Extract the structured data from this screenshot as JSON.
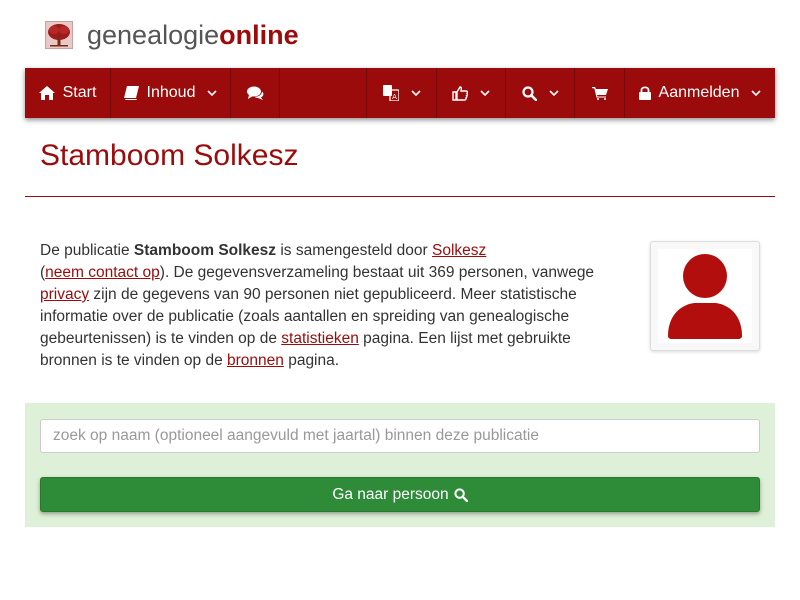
{
  "brand": {
    "name_part1": "genealogie",
    "name_part2": "online",
    "logo_icon": "tree-logo-icon"
  },
  "nav": {
    "start_label": "Start",
    "inhoud_label": "Inhoud",
    "aanmelden_label": "Aanmelden",
    "icons": [
      "home-icon",
      "book-icon",
      "comments-icon",
      "translate-icon",
      "thumbs-up-icon",
      "search-icon",
      "cart-icon",
      "lock-icon"
    ]
  },
  "page": {
    "title": "Stamboom Solkesz"
  },
  "intro": {
    "t1": "De publicatie ",
    "pub_name": "Stamboom Solkesz",
    "t2": " is samengesteld door ",
    "author_link": "Solkesz",
    "t3": "(",
    "contact_link": "neem contact op",
    "t4": "). De gegevensverzameling bestaat uit 369 personen, vanwege ",
    "privacy_link": "privacy",
    "t5": " zijn de gegevens van 90 personen niet gepubliceerd. Meer statistische informatie over de publicatie (zoals aantallen en spreiding van genealogische gebeurtenissen) is te vinden op de ",
    "stats_link": "statistieken",
    "t6": " pagina. Een lijst met gebruikte bronnen is te vinden op de ",
    "sources_link": "bronnen",
    "t7": " pagina."
  },
  "search": {
    "placeholder": "zoek op naam (optioneel aangevuld met jaartal) binnen deze publicatie",
    "button_label": "Ga naar persoon"
  },
  "colors": {
    "brand_red": "#9b0b0b",
    "panel_green": "#dff0d8",
    "button_green": "#2e8b37"
  }
}
